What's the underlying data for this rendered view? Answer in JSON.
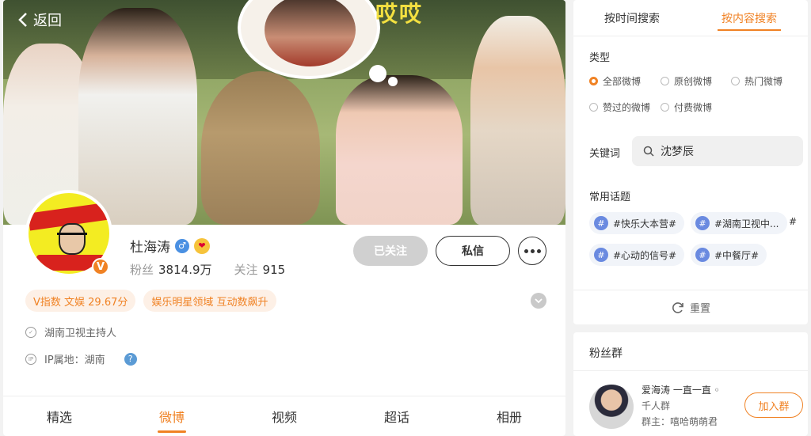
{
  "header": {
    "back_label": "返回",
    "cover_text": "哎哎"
  },
  "profile": {
    "name": "杜海涛",
    "verified_badge": "V",
    "gender_icon": "♂",
    "fans_label": "粉丝",
    "fans_value": "3814.9万",
    "following_label": "关注",
    "following_value": "915",
    "followed_label": "已关注",
    "message_label": "私信",
    "tags": [
      "V指数 文娱 29.67分",
      "娱乐明星领域 互动数飙升"
    ],
    "bio": "湖南卫视主持人",
    "ip_label": "IP属地：湖南",
    "help_icon": "?"
  },
  "tabs": [
    "精选",
    "微博",
    "视频",
    "超话",
    "相册"
  ],
  "active_tab": "微博",
  "search": {
    "tabs": [
      "按时间搜索",
      "按内容搜索"
    ],
    "type_label": "类型",
    "types": [
      "全部微博",
      "原创微博",
      "热门微博",
      "赞过的微博",
      "付费微博"
    ],
    "keyword_label": "关键词",
    "keyword_value": "沈梦辰",
    "topics_label": "常用话题",
    "topics": [
      "#快乐大本营#",
      "#湖南卫视中...",
      "#心动的信号#",
      "#中餐厅#"
    ],
    "topic_more": "#",
    "reset_label": "重置"
  },
  "fans_group": {
    "title": "粉丝群",
    "name": "爱海涛 一直一直 ◦",
    "size": "千人群",
    "owner": "群主：嘻哈萌萌君",
    "join_label": "加入群"
  },
  "colors": {
    "accent": "#f08224",
    "followed_bg": "#d0d0d0"
  }
}
